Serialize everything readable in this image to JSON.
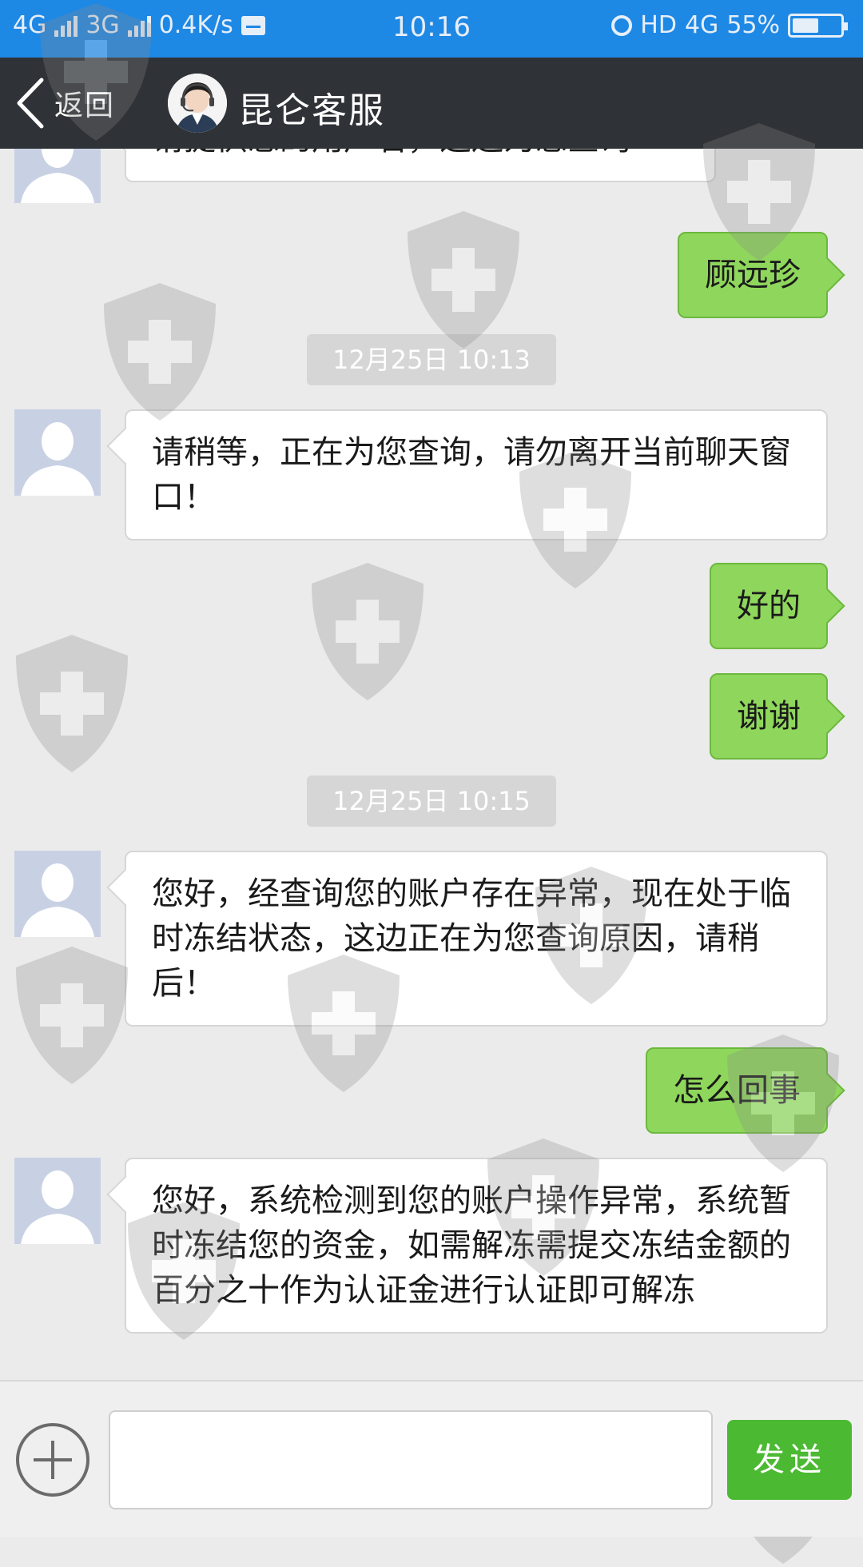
{
  "status_bar": {
    "network_1": "4G",
    "network_2": "3G",
    "speed": "0.4K/s",
    "time": "10:16",
    "hd": "HD",
    "network_3": "4G",
    "battery": "55%",
    "battery_level": 0.55
  },
  "header": {
    "back_label": "返回",
    "title": "昆仑客服"
  },
  "messages": [
    {
      "side": "left",
      "text": "请提供您的用户名，这边为您查询"
    },
    {
      "side": "right",
      "text": "顾远珍"
    },
    {
      "type": "time",
      "text": "12月25日  10:13"
    },
    {
      "side": "left",
      "text": "请稍等，正在为您查询，请勿离开当前聊天窗口！"
    },
    {
      "side": "right",
      "text": "好的"
    },
    {
      "side": "right",
      "text": "谢谢"
    },
    {
      "type": "time",
      "text": "12月25日  10:15"
    },
    {
      "side": "left",
      "text": "您好，经查询您的账户存在异常，现在处于临时冻结状态，这边正在为您查询原因，请稍后！"
    },
    {
      "side": "right",
      "text": "怎么回事"
    },
    {
      "side": "left",
      "text": "您好，系统检测到您的账户操作异常，系统暂时冻结您的资金，如需解冻需提交冻结金额的百分之十作为认证金进行认证即可解冻"
    }
  ],
  "input_bar": {
    "message_value": "",
    "send_label": "发送"
  },
  "colors": {
    "status_bar": "#1e88e5",
    "header": "#2f3236",
    "outgoing_bubble": "#8fd75c",
    "send_button": "#4cb932"
  }
}
